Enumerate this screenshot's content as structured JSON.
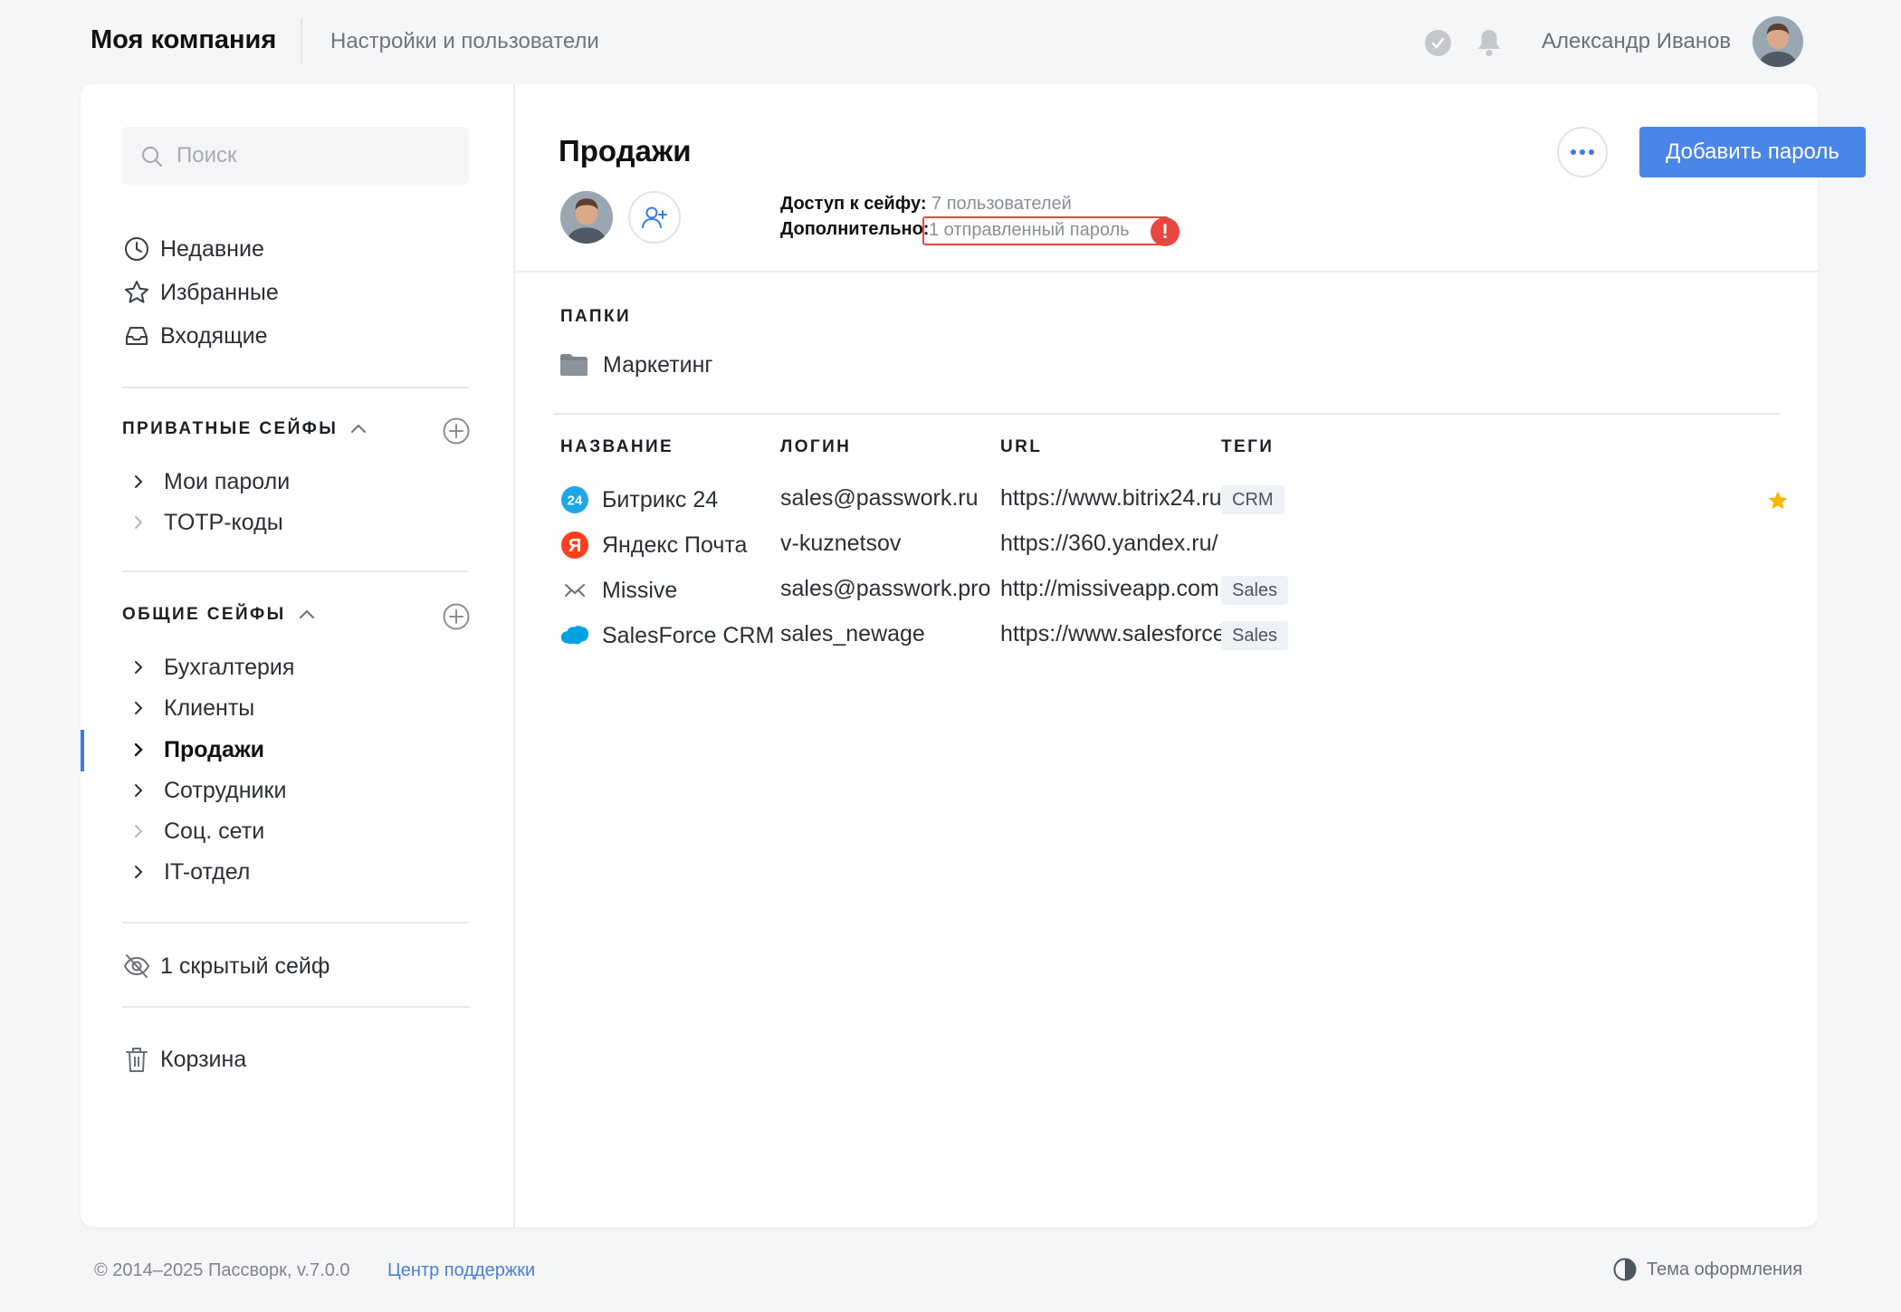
{
  "header": {
    "company": "Моя компания",
    "section": "Настройки и пользователи",
    "user_name": "Александр Иванов"
  },
  "sidebar": {
    "search_placeholder": "Поиск",
    "nav": [
      {
        "label": "Недавние",
        "icon": "clock-icon"
      },
      {
        "label": "Избранные",
        "icon": "star-icon"
      },
      {
        "label": "Входящие",
        "icon": "inbox-icon"
      }
    ],
    "private_title": "ПРИВАТНЫЕ СЕЙФЫ",
    "private_vaults": [
      "Мои пароли",
      "TOTP-коды"
    ],
    "shared_title": "ОБЩИЕ СЕЙФЫ",
    "shared_vaults": [
      "Бухгалтерия",
      "Клиенты",
      "Продажи",
      "Сотрудники",
      "Соц. сети",
      "IT-отдел"
    ],
    "active_vault": "Продажи",
    "hidden": "1 скрытый сейф",
    "trash": "Корзина"
  },
  "vault": {
    "title": "Продажи",
    "more_label": "•••",
    "add_password": "Добавить пароль",
    "access_label": "Доступ к сейфу:",
    "access_value": "7 пользователей",
    "extra_label": "Дополнительно:",
    "extra_value": "1 отправленный пароль",
    "alert": "!"
  },
  "folders": {
    "title": "ПАПКИ",
    "items": [
      "Маркетинг"
    ]
  },
  "table": {
    "columns": [
      "НАЗВАНИЕ",
      "ЛОГИН",
      "URL",
      "ТЕГИ"
    ],
    "rows": [
      {
        "name": "Битрикс 24",
        "login": "sales@passwork.ru",
        "url": "https://www.bitrix24.ru",
        "tag": "CRM",
        "favorite": true,
        "icon": "bitrix24-icon",
        "icon_text": "24"
      },
      {
        "name": "Яндекс Почта",
        "login": "v-kuznetsov",
        "url": "https://360.yandex.ru/",
        "tag": "",
        "favorite": false,
        "icon": "yandex-icon",
        "icon_text": "Я"
      },
      {
        "name": "Missive",
        "login": "sales@passwork.pro",
        "url": "http://missiveapp.com",
        "tag": "Sales",
        "favorite": false,
        "icon": "missive-icon",
        "icon_text": ""
      },
      {
        "name": "SalesForce CRM",
        "login": "sales_newage",
        "url": "https://www.salesforce.com",
        "tag": "Sales",
        "favorite": false,
        "icon": "salesforce-icon",
        "icon_text": ""
      }
    ]
  },
  "footer": {
    "copyright": "© 2014–2025 Пассворк, v.7.0.0",
    "support": "Центр поддержки",
    "theme": "Тема оформления"
  },
  "colors": {
    "accent": "#4a86e8",
    "alert": "#e9463f",
    "favorite": "#f5b800"
  }
}
